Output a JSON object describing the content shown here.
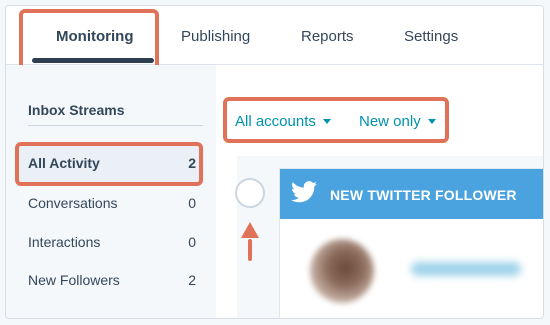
{
  "tabs": {
    "items": [
      {
        "label": "Monitoring",
        "active": true
      },
      {
        "label": "Publishing"
      },
      {
        "label": "Reports"
      },
      {
        "label": "Settings"
      }
    ]
  },
  "sidebar": {
    "title": "Inbox Streams",
    "items": [
      {
        "label": "All Activity",
        "count": "2",
        "active": true
      },
      {
        "label": "Conversations",
        "count": "0"
      },
      {
        "label": "Interactions",
        "count": "0"
      },
      {
        "label": "New Followers",
        "count": "2"
      }
    ]
  },
  "filters": {
    "accounts": "All accounts",
    "status": "New only"
  },
  "feed": {
    "card_title": "NEW TWITTER FOLLOWER",
    "icon": "twitter-bird-icon"
  },
  "colors": {
    "highlight": "#e0725a",
    "accent": "#0091ae",
    "twitter_blue": "#4aa3df",
    "text": "#33475b"
  }
}
